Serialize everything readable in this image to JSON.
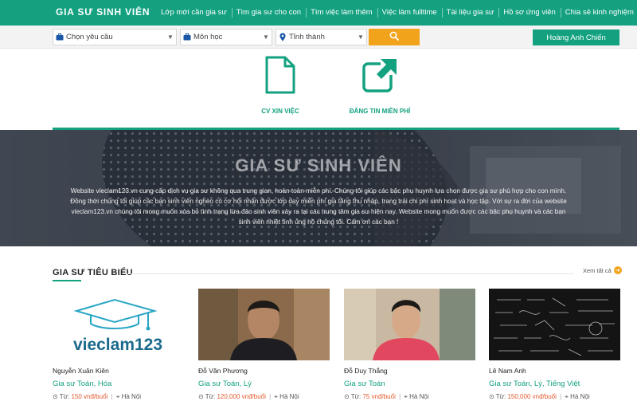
{
  "brand": {
    "logo": "GIA SƯ SINH VIÊN",
    "accent": "#13a180",
    "orange": "#f2a31c"
  },
  "nav": [
    "Lớp mới cần gia sư",
    "Tìm gia sư cho con",
    "Tìm việc làm thêm",
    "Việc làm fulltime",
    "Tài liệu gia sư",
    "Hồ sơ ứng viên",
    "Chia sẻ kinh nghiệm"
  ],
  "search": {
    "requirement": "Chọn yêu cầu",
    "subject": "Môn học",
    "province": "Tỉnh thành",
    "user_name": "Hoàng Anh Chiến"
  },
  "quick_actions": {
    "cv": "CV XIN VIỆC",
    "post": "ĐĂNG TIN MIỄN PHÍ"
  },
  "hero": {
    "title": "GIA SƯ SINH VIÊN",
    "text": "Website vieclam123.vn cung cấp dịch vụ gia sư không qua trung gian, hoàn toàn miễn phí. Chúng tôi giúp các bậc phụ huynh lựa chọn được gia sư phù hợp cho con mình. Đồng thời chúng tôi giúp các bạn sinh viên nghèo có cơ hội nhận được lớp dạy miễn phí gia tăng thu nhập, trang trải chi phí sinh hoạt và học tập. Với sự ra đời của website vieclam123.vn chúng tôi mong muốn xóa bỏ tình trạng lừa đảo sinh viên xảy ra tại các trung tâm gia sư hiện nay. Website mong muốn được các bậc phụ huynh và các bạn sinh viên nhiệt tình ủng hộ chúng tôi. Cám ơn các bạn !"
  },
  "featured": {
    "title": "GIA SƯ TIÊU BIỂU",
    "see_all": "Xem tất cả",
    "tutors": [
      {
        "name": "Nguyễn Xuân Kiên",
        "subjects": "Gia sư Toán, Hóa",
        "fee_label": "Từ:",
        "fee": "150 vnđ/buổi",
        "location": "Hà Nội",
        "photo_text": "vieclam123"
      },
      {
        "name": "Đỗ Văn Phương",
        "subjects": "Gia sư Toán, Lý",
        "fee_label": "Từ:",
        "fee": "120,000 vnđ/buổi",
        "location": "Hà Nội"
      },
      {
        "name": "Đỗ Duy Thắng",
        "subjects": "Gia sư Toán",
        "fee_label": "Từ:",
        "fee": "75 vnđ/buổi",
        "location": "Hà Nội"
      },
      {
        "name": "Lê Nam Anh",
        "subjects": "Gia sư Toán, Lý, Tiếng Việt",
        "fee_label": "Từ:",
        "fee": "150,000 vnđ/buổi",
        "location": "Hà Nội"
      }
    ]
  }
}
